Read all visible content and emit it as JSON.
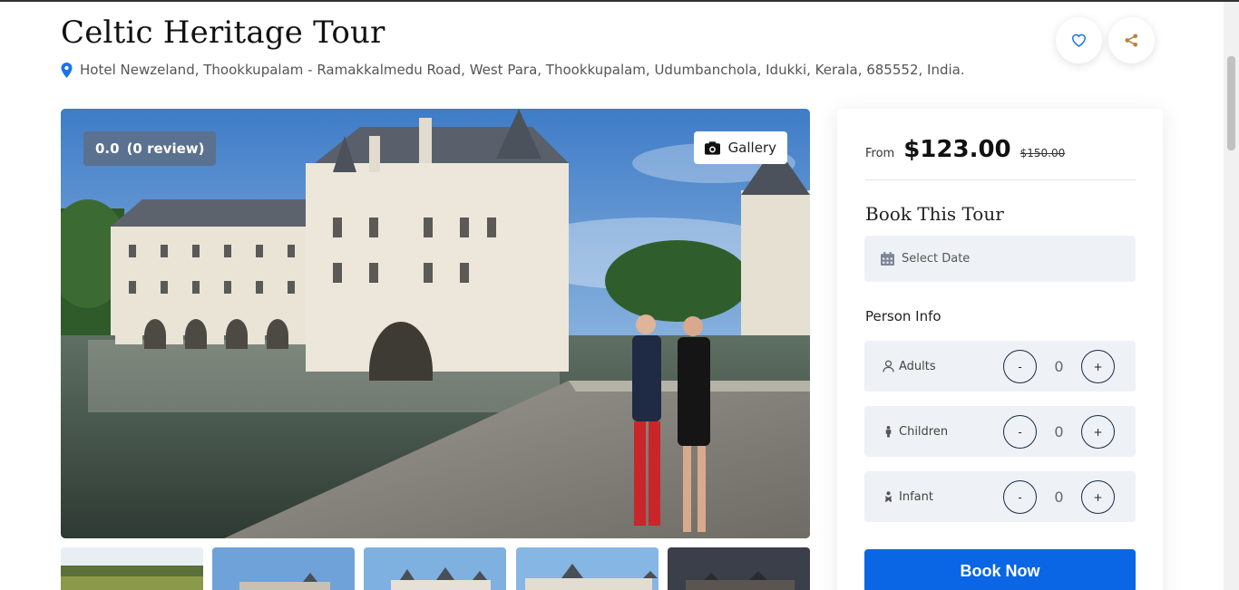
{
  "tour": {
    "title": "Celtic Heritage Tour",
    "address": "Hotel Newzeland, Thookkupalam - Ramakkalmedu Road, West Para, Thookkupalam, Udumbanchola, Idukki, Kerala, 685552, India."
  },
  "actions": {
    "wishlist_icon": "heart-icon",
    "share_icon": "share-icon"
  },
  "hero": {
    "rating_score": "0.0",
    "rating_reviews": "(0 review)",
    "gallery_label": "Gallery",
    "gallery_icon": "camera-icon"
  },
  "thumbnails": [
    "thumbnail-1",
    "thumbnail-2",
    "thumbnail-3",
    "thumbnail-4",
    "thumbnail-5"
  ],
  "booking": {
    "from_label": "From",
    "price": "$123.00",
    "old_price": "$150.00",
    "title": "Book This Tour",
    "date_placeholder": "Select Date",
    "person_info_label": "Person Info",
    "persons": [
      {
        "label": "Adults",
        "icon": "user-icon",
        "count": "0",
        "minus": "-",
        "plus": "+"
      },
      {
        "label": "Children",
        "icon": "child-icon",
        "count": "0",
        "minus": "-",
        "plus": "+"
      },
      {
        "label": "Infant",
        "icon": "baby-icon",
        "count": "0",
        "minus": "-",
        "plus": "+"
      }
    ],
    "book_now_label": "Book Now"
  },
  "colors": {
    "accent_blue": "#0a66e4",
    "rating_badge": "#5b7190",
    "field_bg": "#eef2f6",
    "share_icon": "#b8843a"
  }
}
